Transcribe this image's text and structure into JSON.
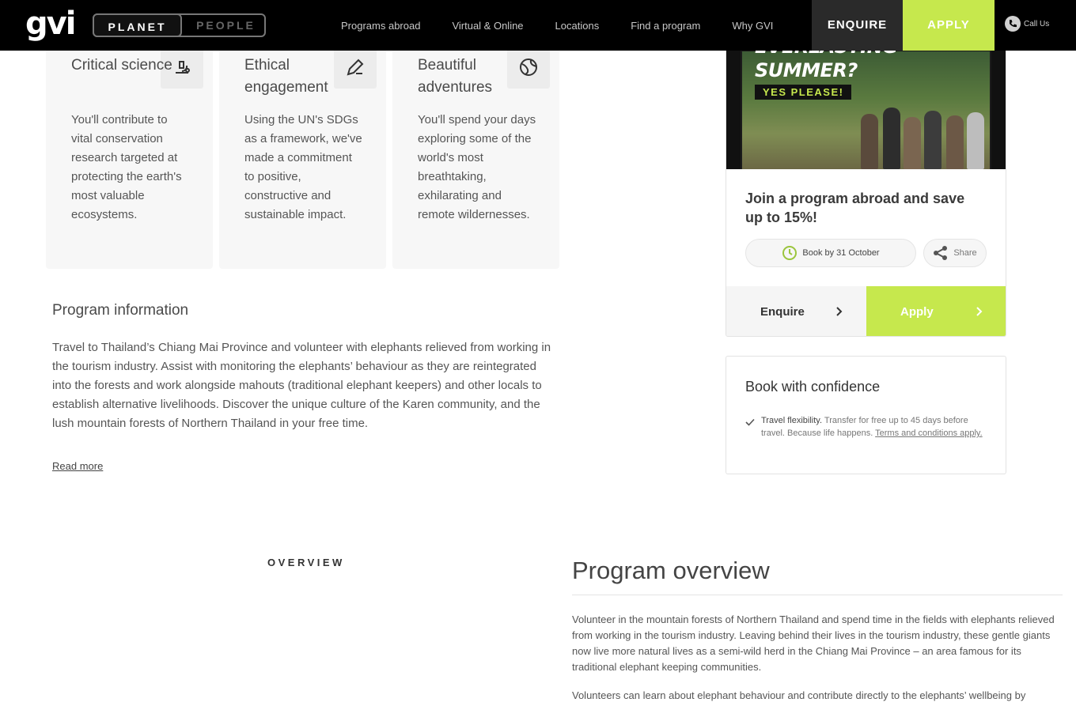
{
  "header": {
    "logo": "gvi",
    "toggle": {
      "planet": "PLANET",
      "people": "PEOPLE"
    },
    "nav": [
      "Programs abroad",
      "Virtual & Online",
      "Locations",
      "Find a program",
      "Why GVI"
    ],
    "enquire": "ENQUIRE",
    "apply": "APPLY",
    "call": "Call Us"
  },
  "cards": [
    {
      "title": "Critical science",
      "text": "You'll contribute to vital conservation research targeted at protecting the earth's most valuable ecosystems.",
      "icon": "microscope-icon"
    },
    {
      "title": "Ethical engagement",
      "text": "Using the UN's SDGs as a framework, we've made a commitment to positive, constructive and sustainable impact.",
      "icon": "pen-icon"
    },
    {
      "title": "Beautiful adventures",
      "text": "You'll spend your days exploring some of the world's most breathtaking, exhilarating and remote wildernesses.",
      "icon": "globe-icon"
    }
  ],
  "program_info": {
    "title": "Program information",
    "text": "Travel to Thailand’s Chiang Mai Province and volunteer with elephants relieved from working in the tourism industry. Assist with monitoring the elephants’ behaviour as they are reintegrated into the forests and work alongside mahouts (traditional elephant keepers) and other locals to establish alternative livelihoods. Discover the unique culture of the Karen community, and the lush mountain forests of Northern Thailand in your free time.",
    "read_more": "Read more"
  },
  "promo": {
    "image_line1": "EVERLASTING",
    "image_line2": "SUMMER?",
    "image_badge": "YES PLEASE!",
    "title": "Join a program abroad and save up to 15%!",
    "book_by": "Book by 31 October",
    "share": "Share",
    "enquire": "Enquire",
    "apply": "Apply"
  },
  "confidence": {
    "title": "Book with confidence",
    "item_bold": "Travel flexibility.",
    "item_text": " Transfer for free up to 45 days before travel. Because life happens. ",
    "item_link": "Terms and conditions apply."
  },
  "overview": {
    "label": "OVERVIEW",
    "title": "Program overview",
    "p1": "Volunteer in the mountain forests of Northern Thailand and spend time in the fields with elephants relieved from working in the tourism industry. Leaving behind their lives in the tourism industry, these gentle giants now live more natural lives as a semi-wild herd in the Chiang Mai Province – an area famous for its traditional elephant keeping communities.",
    "p2": "Volunteers can learn about elephant behaviour and contribute directly to the elephants’ wellbeing by"
  },
  "colors": {
    "accent": "#c6e84d",
    "header_bg": "#000000",
    "card_bg": "#f7f7f7"
  }
}
